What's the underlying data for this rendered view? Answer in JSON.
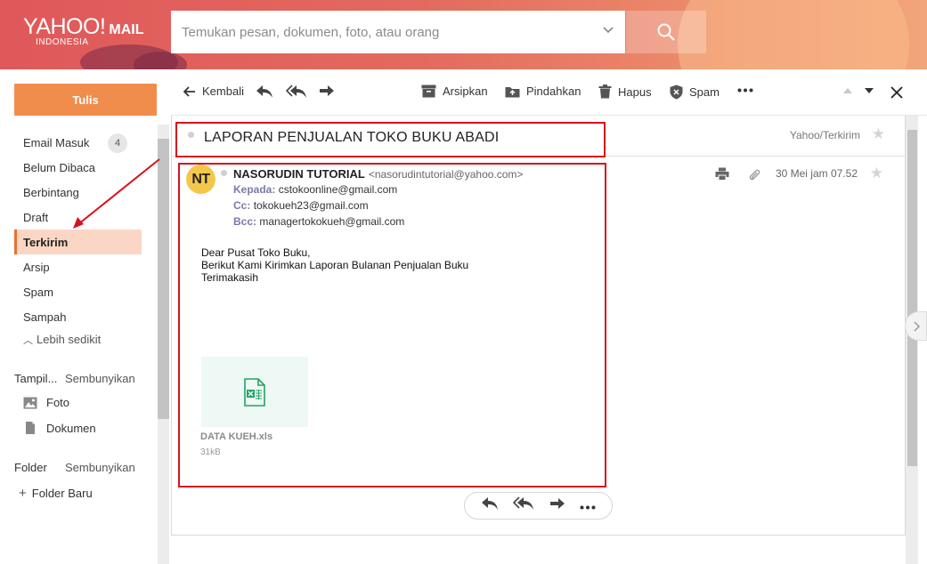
{
  "header": {
    "logo_text": "YAHOO!",
    "logo_mail": "MAIL",
    "logo_country": "INDONESIA",
    "search_placeholder": "Temukan pesan, dokumen, foto, atau orang"
  },
  "sidebar": {
    "compose_label": "Tulis",
    "items": [
      {
        "label": "Email Masuk",
        "count": "4"
      },
      {
        "label": "Belum Dibaca"
      },
      {
        "label": "Berbintang"
      },
      {
        "label": "Draft"
      },
      {
        "label": "Terkirim",
        "active": true
      },
      {
        "label": "Arsip"
      },
      {
        "label": "Spam"
      },
      {
        "label": "Sampah"
      }
    ],
    "less_label": "Lebih sedikit",
    "views_heading": "Tampil...",
    "views_toggle": "Sembunyikan",
    "views": [
      {
        "label": "Foto",
        "icon": "image-icon"
      },
      {
        "label": "Dokumen",
        "icon": "document-icon"
      }
    ],
    "folder_heading": "Folder",
    "folder_toggle": "Sembunyikan",
    "new_folder": "Folder Baru"
  },
  "toolbar": {
    "back": "Kembali",
    "archive": "Arsipkan",
    "move": "Pindahkan",
    "delete": "Hapus",
    "spam": "Spam"
  },
  "message": {
    "subject": "LAPORAN PENJUALAN TOKO BUKU ABADI",
    "folder_path": "Yahoo/Terkirim",
    "avatar_initials": "NT",
    "sender_name": "NASORUDIN TUTORIAL",
    "sender_email": "<nasorudintutorial@yahoo.com>",
    "to_label": "Kepada:",
    "to_value": "cstokoonline@gmail.com",
    "cc_label": "Cc:",
    "cc_value": "tokokueh23@gmail.com",
    "bcc_label": "Bcc:",
    "bcc_value": "managertokokueh@gmail.com",
    "date": "30 Mei jam 07.52",
    "body_lines": [
      "Dear Pusat Toko Buku,",
      "Berikut Kami Kirimkan Laporan Bulanan Penjualan Buku",
      "Terimakasih"
    ],
    "attachment_name": "DATA KUEH.xls",
    "attachment_size": "31kB"
  },
  "colors": {
    "header_start": "#e0585a",
    "compose": "#f08d4c",
    "active_nav": "#fbd6c4",
    "annotation_red": "#d6131d",
    "excel_green": "#21a366"
  }
}
